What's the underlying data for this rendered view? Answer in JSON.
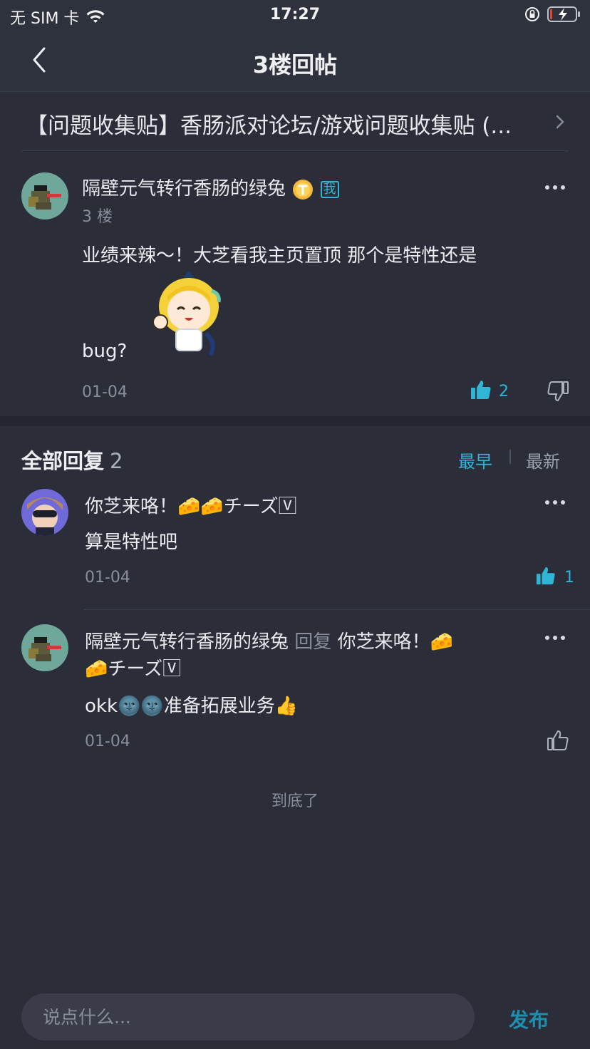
{
  "status_bar": {
    "carrier": "无 SIM 卡",
    "time": "17:27"
  },
  "nav": {
    "title": "3楼回帖"
  },
  "thread": {
    "title": "【问题收集贴】香肠派对论坛/游戏问题收集贴 (..."
  },
  "post": {
    "username": "隔壁元气转行香肠的绿兔",
    "floor": "3 楼",
    "content_line1": "业绩来辣～！大芝看我主页置顶 那个是特性还是",
    "content_line2": "bug?",
    "date": "01-04",
    "like_count": "2",
    "me_badge": "我"
  },
  "replies": {
    "title": "全部回复",
    "count": "2",
    "sort_earliest": "最早",
    "sort_newest": "最新",
    "items": [
      {
        "username": "你芝来咯！🧀🧀チーズ🅅",
        "text": "算是特性吧",
        "date": "01-04",
        "like_count": "1"
      },
      {
        "username": "隔壁元气转行香肠的绿兔",
        "reply_word": "回复",
        "reply_target_line1": "你芝来咯！🧀",
        "reply_target_line2": "🧀チーズ🅅",
        "text": "okk🌚🌚准备拓展业务👍",
        "date": "01-04",
        "like_count": ""
      }
    ]
  },
  "end_text": "到底了",
  "input": {
    "placeholder": "说点什么..."
  },
  "publish_label": "发布",
  "colors": {
    "accent": "#2fb6d6",
    "background": "#2b2e39",
    "header": "#2e323d"
  }
}
